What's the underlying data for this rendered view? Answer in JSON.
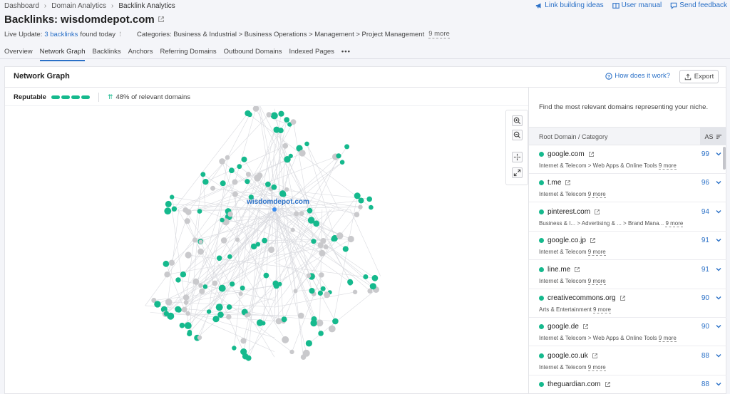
{
  "breadcrumb": [
    "Dashboard",
    "Domain Analytics",
    "Backlink Analytics"
  ],
  "top_links": [
    {
      "label": "Link building ideas",
      "icon": "megaphone-icon"
    },
    {
      "label": "User manual",
      "icon": "book-icon"
    },
    {
      "label": "Send feedback",
      "icon": "chat-icon"
    }
  ],
  "header": {
    "title_prefix": "Backlinks:",
    "domain": "wisdomdepot.com",
    "live_update_prefix": "Live Update:",
    "live_update_link": "3 backlinks",
    "live_update_suffix": "found today",
    "categories": "Categories: Business & Industrial > Business Operations > Management > Project Management",
    "categories_more": "9 more"
  },
  "tabs": [
    "Overview",
    "Network Graph",
    "Backlinks",
    "Anchors",
    "Referring Domains",
    "Outbound Domains",
    "Indexed Pages"
  ],
  "active_tab": "Network Graph",
  "card": {
    "title": "Network Graph",
    "how_link": "How does it work?",
    "export_label": "Export",
    "reputable_label": "Reputable",
    "relevant_pct": "48% of relevant domains",
    "center_label": "wisdomdepot.com"
  },
  "colors": {
    "accent": "#2a70c7",
    "green": "#15b98d",
    "gray_node": "#c9c9cc"
  },
  "side": {
    "description": "Find the most relevant domains representing your niche.",
    "col_domain": "Root Domain / Category",
    "col_as": "AS",
    "rows": [
      {
        "domain": "google.com",
        "category": "Internet & Telecom > Web Apps & Online Tools",
        "more": "9 more",
        "as": "99"
      },
      {
        "domain": "t.me",
        "category": "Internet & Telecom",
        "more": "9 more",
        "as": "96"
      },
      {
        "domain": "pinterest.com",
        "category": "Business & I... > Advertising & ... > Brand Mana...",
        "more": "9 more",
        "as": "94"
      },
      {
        "domain": "google.co.jp",
        "category": "Internet & Telecom",
        "more": "9 more",
        "as": "91"
      },
      {
        "domain": "line.me",
        "category": "Internet & Telecom",
        "more": "9 more",
        "as": "91"
      },
      {
        "domain": "creativecommons.org",
        "category": "Arts & Entertainment",
        "more": "9 more",
        "as": "90"
      },
      {
        "domain": "google.de",
        "category": "Internet & Telecom > Web Apps & Online Tools",
        "more": "9 more",
        "as": "90"
      },
      {
        "domain": "google.co.uk",
        "category": "Internet & Telecom",
        "more": "9 more",
        "as": "88"
      },
      {
        "domain": "theguardian.com",
        "category": "",
        "more": "",
        "as": "88"
      }
    ]
  }
}
